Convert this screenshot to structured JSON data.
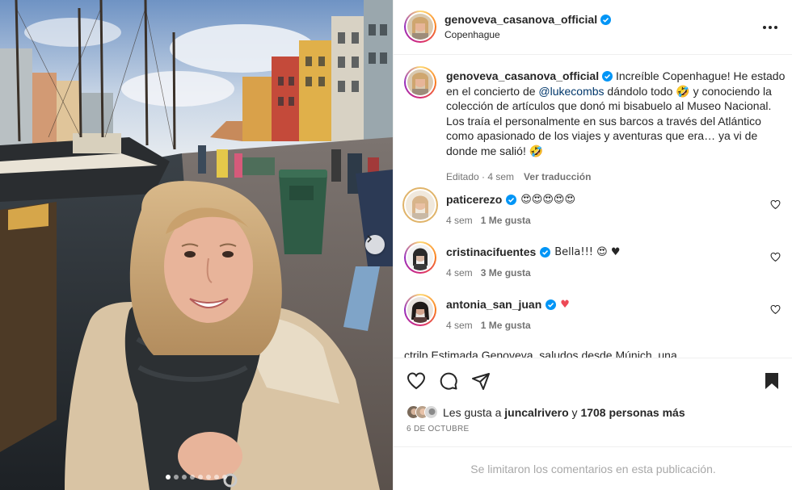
{
  "post": {
    "username": "genoveva_casanova_official",
    "location": "Copenhague",
    "carousel_total": 8,
    "carousel_active_index": 1,
    "colors": {
      "verified": "#0095f6",
      "heart_red": "#ed4956",
      "mention": "#00376b",
      "muted": "#737373"
    }
  },
  "caption": {
    "username": "genoveva_casanova_official",
    "text_1": " Increíble Copenhague! He estado en el concierto de ",
    "mention": "@lukecombs",
    "text_2": " dándolo todo 🤣 y conociendo la colección de artículos que donó mi bisabuelo al Museo Nacional. Los traía el personalmente en sus barcos a través del Atlántico como apasionado de los viajes y aventuras que era… ya vi de donde me salió! 🤣",
    "edited": "Editado · 4 sem",
    "translate": "Ver traducción"
  },
  "comments": [
    {
      "username": "paticerezo",
      "text": "😍😍😍😍😍",
      "time": "4 sem",
      "likes": "1 Me gusta"
    },
    {
      "username": "cristinacifuentes",
      "text": "Bella!!! 😍 ♥",
      "time": "4 sem",
      "likes": "3 Me gusta"
    },
    {
      "username": "antonia_san_juan",
      "text": "♥",
      "time": "4 sem",
      "likes": "1 Me gusta"
    }
  ],
  "partial_comment": "ctrilp Estimada Genoveva, saludos desde Múnich, una",
  "likes": {
    "prefix": "Les gusta a ",
    "user": "juncalrivero",
    "middle": " y ",
    "others": "1708 personas más"
  },
  "date": "6 DE OCTUBRE",
  "comments_limited": "Se limitaron los comentarios en esta publicación.",
  "icons": [
    "more-icon",
    "verified-icon",
    "heart-icon",
    "comment-icon",
    "share-icon",
    "bookmark-icon",
    "next-arrow-icon"
  ]
}
